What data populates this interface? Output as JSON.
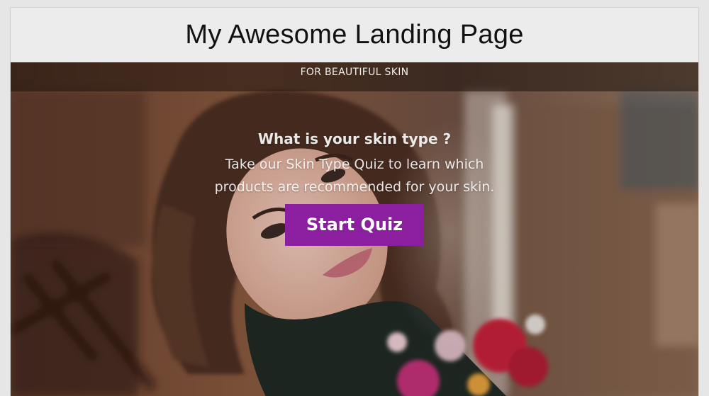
{
  "header": {
    "title": "My Awesome Landing Page"
  },
  "hero": {
    "tagline": "FOR BEAUTIFUL SKIN",
    "question": "What is your skin type ?",
    "lead_lines": [
      "Take our Skin Type Quiz to learn which",
      "products are recommended for your skin."
    ],
    "cta_label": "Start Quiz",
    "photo_icon": "portrait-photo"
  },
  "colors": {
    "cta_background": "#8b1fa0",
    "cta_text": "#ffffff",
    "title_bar_background": "#ececec"
  }
}
